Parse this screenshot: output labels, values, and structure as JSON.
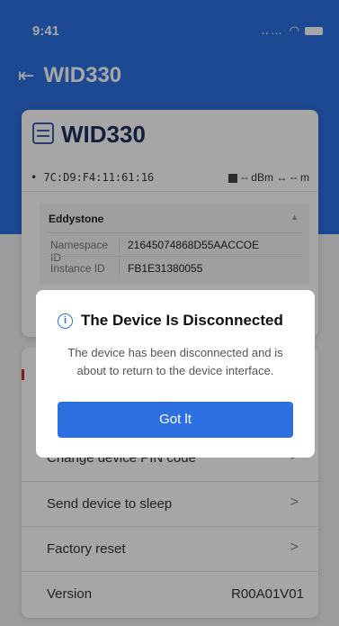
{
  "status_bar": {
    "time": "9:41",
    "signal_icons": "‥… ◠"
  },
  "header": {
    "title": "WID330"
  },
  "device_card": {
    "name": "WID330",
    "mac": "7C:D9:F4:11:61:16",
    "rssi": "-- dBm",
    "distance_sep": "↔",
    "distance": "-- m",
    "beacon": {
      "type": "Eddystone",
      "rows": [
        {
          "label": "Namespace ID",
          "value": "21645074868D55AACCOE"
        },
        {
          "label": "Instance ID",
          "value": "FB1E31380055"
        }
      ]
    }
  },
  "menu": {
    "items": [
      {
        "label": "Change device PIN code",
        "chevron": ">"
      },
      {
        "label": "Send device to sleep",
        "chevron": ">"
      },
      {
        "label": "Factory reset",
        "chevron": ">"
      }
    ],
    "version": {
      "label": "Version",
      "value": "R00A01V01"
    }
  },
  "dialog": {
    "icon": "i",
    "title": "The Device Is Disconnected",
    "message": "The device has been disconnected and is about to return to the device interface.",
    "button": "Got lt"
  },
  "colors": {
    "accent": "#2d6fe0",
    "title_dark": "#1c2f5c"
  }
}
